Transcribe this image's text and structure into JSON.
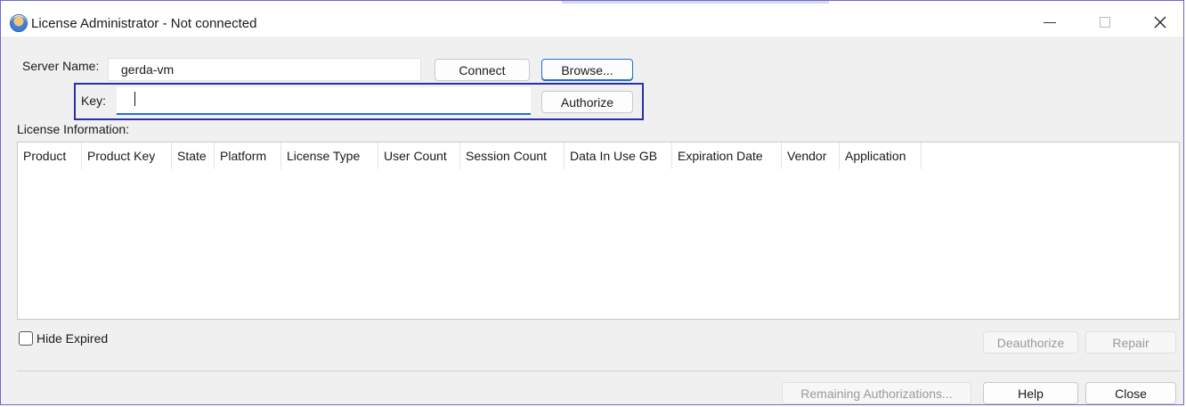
{
  "window": {
    "title": "License Administrator - Not connected",
    "icon": "license-admin-app-icon",
    "controls": {
      "minimize": "minimize-icon",
      "maximize": "maximize-icon",
      "close": "close-icon"
    }
  },
  "server": {
    "label": "Server Name:",
    "value": "gerda-vm",
    "connect_label": "Connect",
    "browse_label": "Browse..."
  },
  "key": {
    "label": "Key:",
    "value": "",
    "authorize_label": "Authorize"
  },
  "license_info": {
    "label": "License Information:",
    "columns": [
      "Product",
      "Product Key",
      "State",
      "Platform",
      "License Type",
      "User Count",
      "Session Count",
      "Data In Use GB",
      "Expiration Date",
      "Vendor",
      "Application"
    ],
    "rows": []
  },
  "hide_expired": {
    "label": "Hide Expired",
    "checked": false
  },
  "actions": {
    "deauthorize_label": "Deauthorize",
    "repair_label": "Repair",
    "remaining_label": "Remaining Authorizations...",
    "help_label": "Help",
    "close_label": "Close"
  },
  "colors": {
    "highlight": "#2e2ea8",
    "focus": "#1f6fcf"
  }
}
